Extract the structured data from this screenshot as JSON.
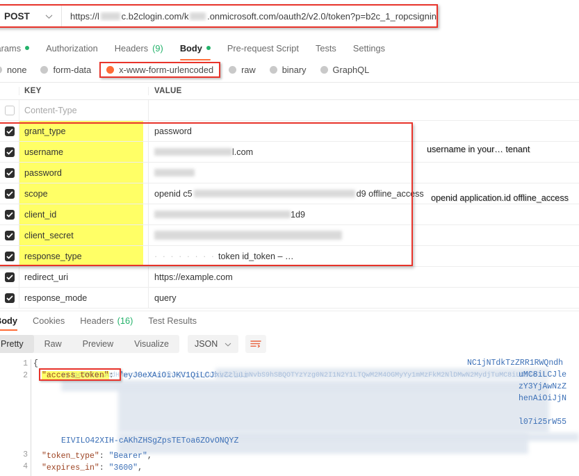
{
  "request": {
    "method": "POST",
    "url": "https://l████c.b2clogin.com/k█████.onmicrosoft.com/oauth2/v2.0/token?p=b2c_1_ropcsignin",
    "url_prefix": "https://l",
    "url_mid": "c.b2clogin.com/k",
    "url_suffix": ".onmicrosoft.com/oauth2/v2.0/token?p=b2c_1_ropcsignin",
    "tabs": [
      {
        "label": "Params",
        "dot": true,
        "count": ""
      },
      {
        "label": "Authorization",
        "dot": false,
        "count": ""
      },
      {
        "label": "Headers",
        "dot": false,
        "count": "(9)"
      },
      {
        "label": "Body",
        "dot": true,
        "count": ""
      },
      {
        "label": "Pre-request Script",
        "dot": false,
        "count": ""
      },
      {
        "label": "Tests",
        "dot": false,
        "count": ""
      },
      {
        "label": "Settings",
        "dot": false,
        "count": ""
      }
    ],
    "active_tab": "Body",
    "body_types": [
      {
        "label": "none",
        "selected": false
      },
      {
        "label": "form-data",
        "selected": false
      },
      {
        "label": "x-www-form-urlencoded",
        "selected": true
      },
      {
        "label": "raw",
        "selected": false
      },
      {
        "label": "binary",
        "selected": false
      },
      {
        "label": "GraphQL",
        "selected": false
      }
    ]
  },
  "table": {
    "headers": {
      "key": "KEY",
      "value": "VALUE"
    },
    "rows": [
      {
        "checked": false,
        "key": "Content-Type",
        "value": "",
        "highlight": false,
        "placeholder": true,
        "redacted": "none"
      },
      {
        "checked": true,
        "key": "grant_type",
        "value": "password",
        "highlight": true,
        "placeholder": false,
        "redacted": "none"
      },
      {
        "checked": true,
        "key": "username",
        "value": "l.com",
        "highlight": true,
        "placeholder": false,
        "redacted": "lead"
      },
      {
        "checked": true,
        "key": "password",
        "value": "",
        "highlight": true,
        "placeholder": false,
        "redacted": "pass"
      },
      {
        "checked": true,
        "key": "scope",
        "value": "openid  c5",
        "value_tail": "d9 offline_access",
        "highlight": true,
        "placeholder": false,
        "redacted": "mid"
      },
      {
        "checked": true,
        "key": "client_id",
        "value": "",
        "value_tail": "1d9",
        "highlight": true,
        "placeholder": false,
        "redacted": "mid2"
      },
      {
        "checked": true,
        "key": "client_secret",
        "value": "",
        "highlight": true,
        "placeholder": false,
        "redacted": "full"
      },
      {
        "checked": true,
        "key": "response_type",
        "value": "token id_token – …",
        "highlight": true,
        "placeholder": false,
        "redacted": "dots"
      },
      {
        "checked": true,
        "key": "redirect_uri",
        "value": "https://example.com",
        "highlight": false,
        "placeholder": false,
        "redacted": "none"
      },
      {
        "checked": true,
        "key": "response_mode",
        "value": "query",
        "highlight": false,
        "placeholder": false,
        "redacted": "none"
      }
    ]
  },
  "annotations": {
    "username_note": "username  in  your…     tenant",
    "scope_note": "openid application.id offline_access"
  },
  "response": {
    "tabs": [
      {
        "label": "Body",
        "count": ""
      },
      {
        "label": "Cookies",
        "count": ""
      },
      {
        "label": "Headers",
        "count": "(16)"
      },
      {
        "label": "Test Results",
        "count": ""
      }
    ],
    "active_tab": "Body",
    "view_modes": [
      "Pretty",
      "Raw",
      "Preview",
      "Visualize"
    ],
    "active_view": "Pretty",
    "language": "JSON",
    "format_icon": "wrap-lines-icon"
  },
  "code": {
    "line_numbers": [
      "1",
      "2",
      "3",
      "4"
    ],
    "line1": "{",
    "token_key": "\"access_token\"",
    "token_colon": ":",
    "token_value_start": "\"eyJ0eXAiOiJKV1QiLCJhbGciOi",
    "jwt_fragments": [
      "NC1jNTdkTzZRR1RWQndh",
      "uMC8iLCJle",
      "zY3YjAwNzZ",
      "henAiOiJjN",
      "l07i25rW55"
    ],
    "jwt_line2": "eyJpc3MiOiJodHRwczovL2tdnlhYjI1LmTyV2xvZ2luLmNvbS9hSBQOTYzYzg0N2I1N2Y1LTQwM2M4OGMyYy1mMzFkM2NlDMwN2MydjTuMC8iLCJle",
    "jwt_tail": "EIVILO42XIH-cAKhZHSgZpsTEToa6ZOvONQYZ",
    "line3_key": "\"token_type\"",
    "line3_val": "\"Bearer\"",
    "line4_key": "\"expires_in\"",
    "line4_val": "\"3600\""
  },
  "colors": {
    "accent": "#ff6c37",
    "highlight_red": "#e8332a",
    "highlight_yellow": "#ffff66",
    "dot_green": "#23b26a",
    "string_blue": "#3b6fb6",
    "key_brown": "#9c4221"
  }
}
